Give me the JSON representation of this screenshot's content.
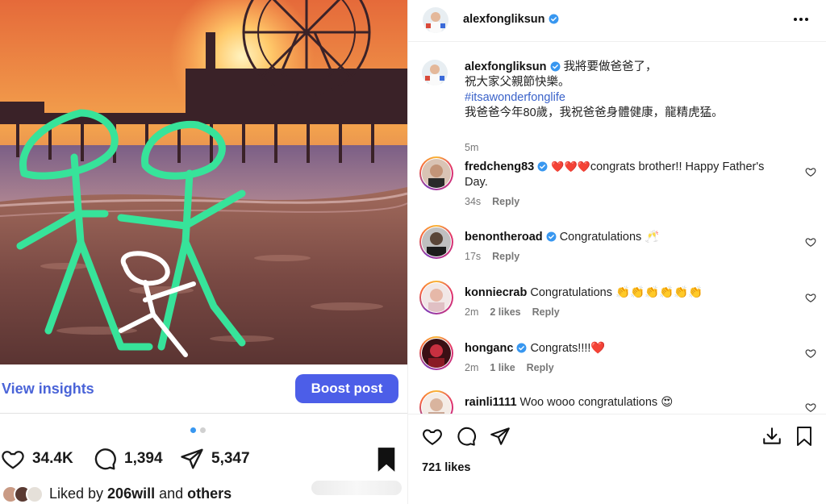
{
  "post": {
    "insights_label": "View insights",
    "boost_label": "Boost post",
    "likes": "34.4K",
    "comments": "1,394",
    "shares": "5,347",
    "liked_by_prefix": "Liked by ",
    "liked_by_user": "206will",
    "liked_by_and": " and ",
    "liked_by_others": "others",
    "carousel_index": 1,
    "carousel_total": 2
  },
  "panel": {
    "username": "alexfongliksun",
    "caption": {
      "username": "alexfongliksun",
      "line1": "我將要做爸爸了，",
      "line2": "祝大家父親節快樂。",
      "hashtag": "#itsawonderfonglife",
      "line3": "我爸爸今年80歲，我祝爸爸身體健康，龍精虎猛。",
      "time": "5m"
    },
    "comments": [
      {
        "username": "fredcheng83",
        "emoji": "❤️❤️❤️",
        "text": "congrats brother!! Happy Father's Day.",
        "time": "34s",
        "likes": "",
        "reply": "Reply"
      },
      {
        "username": "benontheroad",
        "emoji": "",
        "text": "Congratulations 🥂",
        "time": "17s",
        "likes": "",
        "reply": "Reply"
      },
      {
        "username": "konniecrab",
        "emoji": "",
        "text": "Congratulations 👏👏👏👏👏👏",
        "time": "2m",
        "likes": "2 likes",
        "reply": "Reply"
      },
      {
        "username": "honganc",
        "emoji": "",
        "text": "Congrats!!!!❤️",
        "time": "2m",
        "likes": "1 like",
        "reply": "Reply"
      },
      {
        "username": "rainli1111",
        "emoji": "",
        "text": "Woo wooo congratulations 😍",
        "time": "",
        "likes": "",
        "reply": ""
      }
    ],
    "likes_text": "721 likes"
  },
  "icons": [
    "heart-icon",
    "comment-icon",
    "share-icon",
    "bookmark-icon",
    "more-icon",
    "verified-icon",
    "download-icon"
  ],
  "colors": {
    "accent_blue": "#4c5ee8",
    "link_blue": "#4a64d8",
    "verified": "#3897f0",
    "drawing_green": "#37e39a"
  }
}
